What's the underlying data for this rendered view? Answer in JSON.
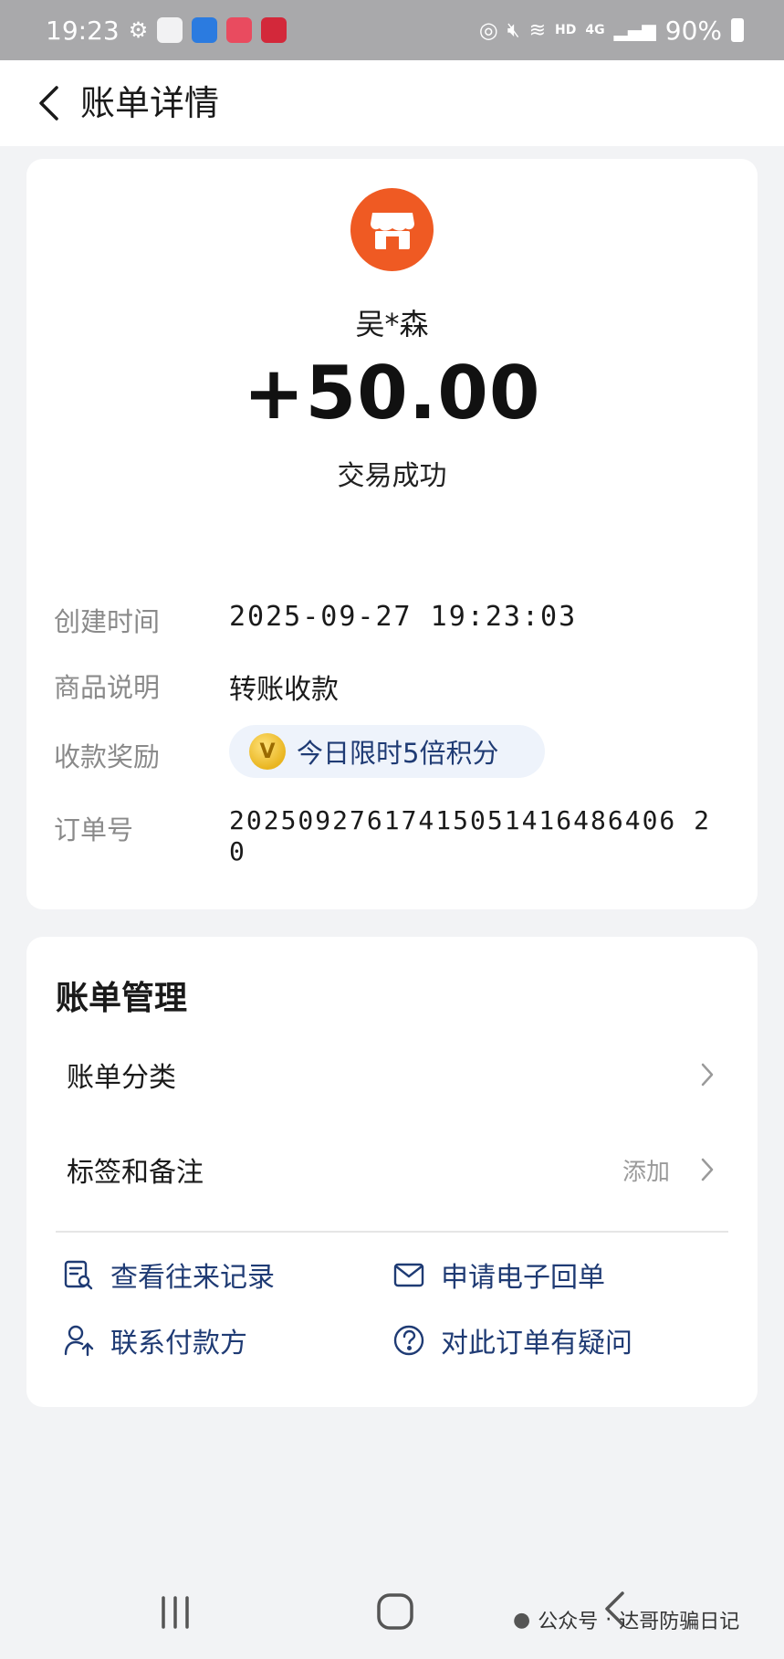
{
  "status_bar": {
    "time": "19:23",
    "battery": "90%",
    "network": "4G",
    "hd": "HD"
  },
  "nav": {
    "title": "账单详情"
  },
  "transaction": {
    "payer_name": "吴*森",
    "amount": "+50.00",
    "status": "交易成功"
  },
  "details": {
    "created_label": "创建时间",
    "created_value": "2025-09-27 19:23:03",
    "desc_label": "商品说明",
    "desc_value": "转账收款",
    "reward_label": "收款奖励",
    "reward_value": "今日限时5倍积分",
    "order_label": "订单号",
    "order_value": "20250927617415051416486406 20"
  },
  "management": {
    "title": "账单管理",
    "category_label": "账单分类",
    "tags_label": "标签和备注",
    "tags_hint": "添加",
    "actions": {
      "history": "查看往来记录",
      "receipt": "申请电子回单",
      "contact": "联系付款方",
      "question": "对此订单有疑问"
    }
  },
  "watermark": {
    "source": "公众号",
    "name": "达哥防骗日记"
  },
  "colors": {
    "accent_blue": "#1f3b74",
    "merchant_orange": "#ef5a23",
    "status_bar": "#a9a9ab"
  }
}
